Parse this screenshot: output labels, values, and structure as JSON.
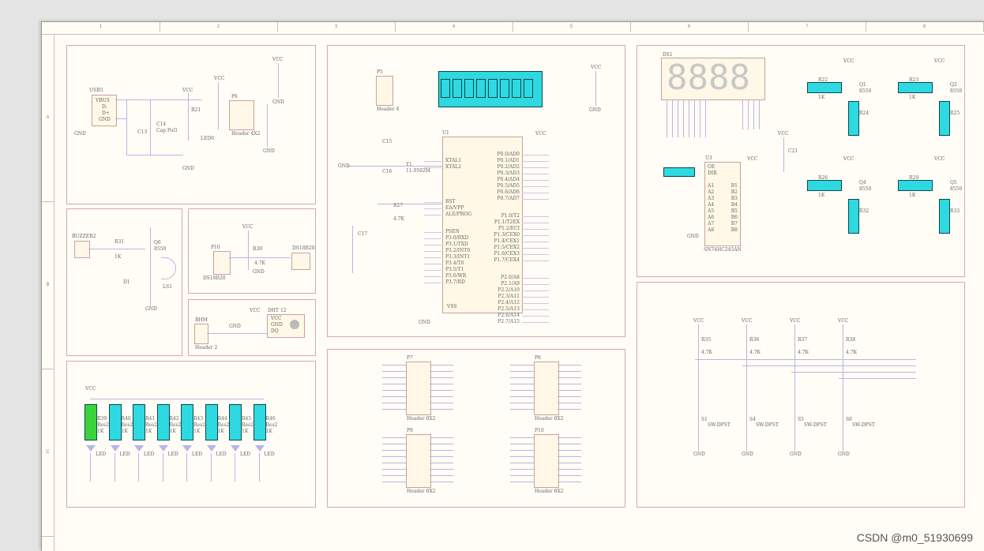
{
  "ruler": {
    "columns": [
      "1",
      "2",
      "3",
      "4",
      "5",
      "6",
      "7",
      "8"
    ],
    "rows": [
      "A",
      "B",
      "C"
    ]
  },
  "blocks": {
    "power": {
      "usb": "USB5",
      "usb_pins": [
        "VBUS",
        "D-",
        "D+",
        "GND"
      ],
      "vcc": "VCC",
      "gnd": "GND",
      "c": "C14",
      "c_val": "Cap Pol1",
      "c13": "C13",
      "led": "LED0",
      "r": "R21",
      "header": "Header 4X2",
      "header_name": "P6"
    },
    "buzzer": {
      "header": "BUZZER2",
      "r": "R31",
      "val": "1K",
      "q": "Q6",
      "q_type": "8550",
      "d": "D1",
      "out": "LS1"
    },
    "ds18b20": {
      "name": "DS18B20",
      "p": "P10",
      "r": "R30",
      "r_val": "4.7K",
      "vcc": "VCC",
      "gnd": "GND"
    },
    "dht11": {
      "name": "DHT 12",
      "p": "BHM",
      "pins": [
        "VCC",
        "GND",
        "DQ"
      ],
      "header": "Header 2"
    },
    "mcu": {
      "name": "U1",
      "left_pins": [
        "XTAL1",
        "XTAL2",
        "RST",
        "EA/VPP",
        "ALE/PROG",
        "PSEN",
        "P3.0/RXD",
        "P3.1/TXD",
        "P3.2/INT0",
        "P3.3/INT1",
        "P3.4/T0",
        "P3.5/T1",
        "P3.6/WR",
        "P3.7/RD"
      ],
      "right_pins": [
        "P0.0/AD0",
        "P0.1/AD1",
        "P0.2/AD2",
        "P0.3/AD3",
        "P0.4/AD4",
        "P0.5/AD5",
        "P0.6/AD6",
        "P0.7/AD7",
        "P1.0/T2",
        "P1.1/T2EX",
        "P1.2/ECI",
        "P1.3/CEX0",
        "P1.4/CEX1",
        "P1.5/CEX2",
        "P1.6/CEX3",
        "P1.7/CEX4",
        "P2.0/A8",
        "P2.1/A9",
        "P2.2/A10",
        "P2.3/A11",
        "P2.4/A12",
        "P2.5/A13",
        "P2.6/A14",
        "P2.7/A15"
      ],
      "vcc": "VCC",
      "vss": "VSS",
      "gnd": "GND",
      "caps": [
        "C15",
        "C16",
        "C17"
      ],
      "xtal": "Y1",
      "xtal_val": "11.0592M",
      "r": "R27",
      "r_val": "4.7K",
      "p": "P5",
      "header4": "Header 4"
    },
    "display": {
      "name": "DS1",
      "digits": "8888",
      "buffer": "SN74HC245AN",
      "buffer_name": "U3",
      "pins_a": [
        "OE",
        "DIR",
        "A1",
        "A2",
        "A3",
        "A4",
        "A5",
        "A6",
        "A7",
        "A8"
      ],
      "pins_b": [
        "B1",
        "B2",
        "B3",
        "B4",
        "B5",
        "B6",
        "B7",
        "B8"
      ],
      "gnd": "GND",
      "vcc": "VCC",
      "cap": "C21"
    },
    "transistors": [
      {
        "r1": "R22",
        "r2": "R24",
        "q": "Q1",
        "type": "8550",
        "v": "1K"
      },
      {
        "r1": "R23",
        "r2": "R25",
        "q": "Q2",
        "type": "8550",
        "v": "1K"
      },
      {
        "r1": "R26",
        "r2": "R32",
        "q": "Q4",
        "type": "8550",
        "v": "1K"
      },
      {
        "r1": "R29",
        "r2": "R33",
        "q": "Q5",
        "type": "8550",
        "v": "1K"
      }
    ],
    "leds": {
      "vcc": "VCC",
      "resistors": [
        "R39",
        "R40",
        "R41",
        "R42",
        "R43",
        "R44",
        "R45",
        "R46"
      ],
      "res_label": "Res2",
      "res_val": "1K",
      "led": "LED"
    },
    "headers": [
      {
        "name": "P7",
        "title": "Header 8X2"
      },
      {
        "name": "P8",
        "title": "Header 8X2"
      },
      {
        "name": "P9",
        "title": "Header 8X2"
      },
      {
        "name": "P10",
        "title": "Header 8X2"
      }
    ],
    "switches": {
      "items": [
        {
          "r": "R35",
          "s": "S1"
        },
        {
          "r": "R36",
          "s": "S4"
        },
        {
          "r": "R37",
          "s": "S5"
        },
        {
          "r": "R38",
          "s": "S6"
        }
      ],
      "type": "SW-DPST",
      "vcc": "VCC",
      "gnd": "GND",
      "r_val": "4.7K"
    }
  },
  "watermark": "CSDN @m0_51930699",
  "colors": {
    "background": "#e4e4e4",
    "paper": "#fffdf6",
    "border": "#d8a8a8",
    "wire": "#b6b6e6",
    "selected": "#2fd9e2",
    "selected_green": "#3ad33a"
  }
}
